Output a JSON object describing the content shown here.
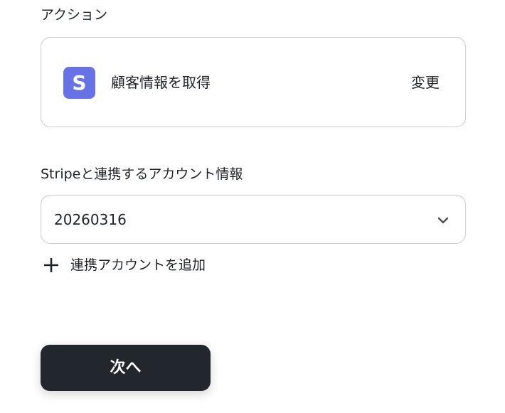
{
  "action_section": {
    "label": "アクション",
    "app_logo_letter": "S",
    "app_logo_color": "#6772e5",
    "action_name": "顧客情報を取得",
    "change_label": "変更"
  },
  "account_section": {
    "label": "Stripeと連携するアカウント情報",
    "selected_account": "20260316",
    "add_account_label": "連携アカウントを追加"
  },
  "footer": {
    "next_label": "次へ",
    "next_button_color": "#22262d"
  }
}
